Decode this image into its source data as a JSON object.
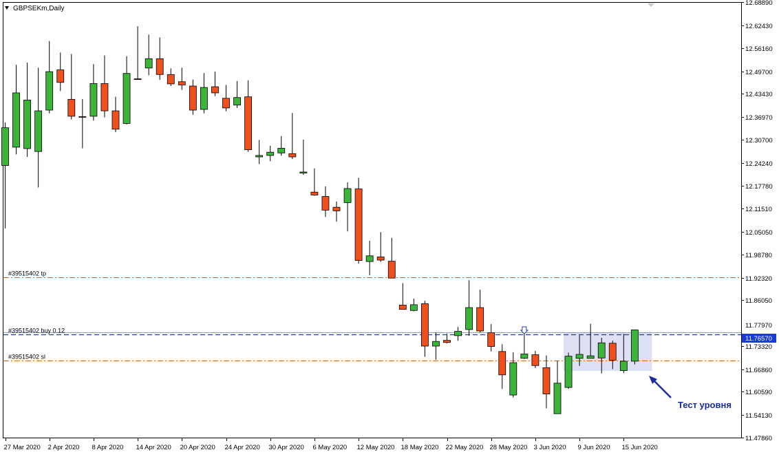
{
  "window": {
    "title": "GBPSEKm,Daily"
  },
  "colors": {
    "bull": "#3cb43c",
    "bear": "#f0501e",
    "wick": "#000000",
    "trade_level": "#d2691e",
    "buy_line": "#1f3f7a",
    "current_price_bg": "#1a3cd6",
    "annotation": "#1a2aa0",
    "highlight": "#d8dcf4"
  },
  "chart_data": {
    "type": "candlestick",
    "symbol": "GBPSEKm",
    "timeframe": "Daily",
    "ylim": [
      11.4786,
      12.6889
    ],
    "y_ticks": [
      "12.68890",
      "12.62430",
      "12.56160",
      "12.49700",
      "12.43430",
      "12.36970",
      "12.30700",
      "12.24240",
      "12.17780",
      "12.11510",
      "12.05050",
      "11.98780",
      "11.92320",
      "11.86050",
      "11.79590",
      "11.73320",
      "11.66860",
      "11.60590",
      "11.54130",
      "11.47860"
    ],
    "x_ticks": [
      "27 Mar 2020",
      "2 Apr 2020",
      "8 Apr 2020",
      "14 Apr 2020",
      "20 Apr 2020",
      "24 Apr 2020",
      "30 Apr 2020",
      "6 May 2020",
      "12 May 2020",
      "18 May 2020",
      "22 May 2020",
      "28 May 2020",
      "3 Jun 2020",
      "9 Jun 2020",
      "15 Jun 2020"
    ],
    "x_tick_bar_index": [
      0,
      4,
      8,
      12,
      16,
      20,
      24,
      28,
      32,
      36,
      40,
      44,
      48,
      52,
      56
    ],
    "candles": [
      {
        "o": 12.235,
        "h": 12.355,
        "l": 12.06,
        "c": 12.34
      },
      {
        "o": 12.286,
        "h": 12.515,
        "l": 12.266,
        "c": 12.437
      },
      {
        "o": 12.282,
        "h": 12.521,
        "l": 12.259,
        "c": 12.417
      },
      {
        "o": 12.274,
        "h": 12.507,
        "l": 12.174,
        "c": 12.387
      },
      {
        "o": 12.389,
        "h": 12.581,
        "l": 12.38,
        "c": 12.496
      },
      {
        "o": 12.501,
        "h": 12.549,
        "l": 12.442,
        "c": 12.466
      },
      {
        "o": 12.419,
        "h": 12.545,
        "l": 12.363,
        "c": 12.372
      },
      {
        "o": 12.371,
        "h": 12.42,
        "l": 12.283,
        "c": 12.369
      },
      {
        "o": 12.372,
        "h": 12.517,
        "l": 12.36,
        "c": 12.463
      },
      {
        "o": 12.463,
        "h": 12.541,
        "l": 12.369,
        "c": 12.387
      },
      {
        "o": 12.387,
        "h": 12.426,
        "l": 12.328,
        "c": 12.336
      },
      {
        "o": 12.352,
        "h": 12.539,
        "l": 12.349,
        "c": 12.491
      },
      {
        "o": 12.476,
        "h": 12.622,
        "l": 12.474,
        "c": 12.474
      },
      {
        "o": 12.506,
        "h": 12.599,
        "l": 12.486,
        "c": 12.532
      },
      {
        "o": 12.532,
        "h": 12.591,
        "l": 12.473,
        "c": 12.488
      },
      {
        "o": 12.488,
        "h": 12.505,
        "l": 12.456,
        "c": 12.462
      },
      {
        "o": 12.468,
        "h": 12.507,
        "l": 12.445,
        "c": 12.459
      },
      {
        "o": 12.456,
        "h": 12.474,
        "l": 12.376,
        "c": 12.389
      },
      {
        "o": 12.391,
        "h": 12.492,
        "l": 12.38,
        "c": 12.452
      },
      {
        "o": 12.454,
        "h": 12.496,
        "l": 12.428,
        "c": 12.437
      },
      {
        "o": 12.422,
        "h": 12.459,
        "l": 12.386,
        "c": 12.395
      },
      {
        "o": 12.403,
        "h": 12.47,
        "l": 12.395,
        "c": 12.424
      },
      {
        "o": 12.426,
        "h": 12.472,
        "l": 12.273,
        "c": 12.279
      },
      {
        "o": 12.259,
        "h": 12.306,
        "l": 12.239,
        "c": 12.263
      },
      {
        "o": 12.263,
        "h": 12.29,
        "l": 12.247,
        "c": 12.272
      },
      {
        "o": 12.27,
        "h": 12.317,
        "l": 12.262,
        "c": 12.283
      },
      {
        "o": 12.268,
        "h": 12.381,
        "l": 12.253,
        "c": 12.259
      },
      {
        "o": 12.214,
        "h": 12.307,
        "l": 12.209,
        "c": 12.217
      },
      {
        "o": 12.161,
        "h": 12.227,
        "l": 12.151,
        "c": 12.153
      },
      {
        "o": 12.149,
        "h": 12.177,
        "l": 12.092,
        "c": 12.111
      },
      {
        "o": 12.119,
        "h": 12.135,
        "l": 12.079,
        "c": 12.109
      },
      {
        "o": 12.132,
        "h": 12.188,
        "l": 12.052,
        "c": 12.171
      },
      {
        "o": 12.17,
        "h": 12.201,
        "l": 11.962,
        "c": 11.971
      },
      {
        "o": 11.968,
        "h": 12.026,
        "l": 11.93,
        "c": 11.984
      },
      {
        "o": 11.981,
        "h": 12.05,
        "l": 11.967,
        "c": 11.972
      },
      {
        "o": 11.969,
        "h": 12.034,
        "l": 11.926,
        "c": 11.922
      },
      {
        "o": 11.847,
        "h": 11.908,
        "l": 11.835,
        "c": 11.835
      },
      {
        "o": 11.832,
        "h": 11.865,
        "l": 11.83,
        "c": 11.848
      },
      {
        "o": 11.851,
        "h": 11.859,
        "l": 11.703,
        "c": 11.733
      },
      {
        "o": 11.733,
        "h": 11.771,
        "l": 11.695,
        "c": 11.746
      },
      {
        "o": 11.749,
        "h": 11.768,
        "l": 11.741,
        "c": 11.743
      },
      {
        "o": 11.762,
        "h": 11.786,
        "l": 11.748,
        "c": 11.774
      },
      {
        "o": 11.779,
        "h": 11.916,
        "l": 11.762,
        "c": 11.84
      },
      {
        "o": 11.84,
        "h": 11.89,
        "l": 11.771,
        "c": 11.775
      },
      {
        "o": 11.77,
        "h": 11.794,
        "l": 11.718,
        "c": 11.732
      },
      {
        "o": 11.718,
        "h": 11.738,
        "l": 11.614,
        "c": 11.653
      },
      {
        "o": 11.597,
        "h": 11.716,
        "l": 11.59,
        "c": 11.687
      },
      {
        "o": 11.699,
        "h": 11.774,
        "l": 11.697,
        "c": 11.711
      },
      {
        "o": 11.709,
        "h": 11.72,
        "l": 11.672,
        "c": 11.679
      },
      {
        "o": 11.673,
        "h": 11.707,
        "l": 11.56,
        "c": 11.6
      },
      {
        "o": 11.545,
        "h": 11.692,
        "l": 11.546,
        "c": 11.63
      },
      {
        "o": 11.618,
        "h": 11.715,
        "l": 11.614,
        "c": 11.705
      },
      {
        "o": 11.699,
        "h": 11.763,
        "l": 11.678,
        "c": 11.71
      },
      {
        "o": 11.699,
        "h": 11.795,
        "l": 11.699,
        "c": 11.706
      },
      {
        "o": 11.7,
        "h": 11.756,
        "l": 11.657,
        "c": 11.742
      },
      {
        "o": 11.741,
        "h": 11.748,
        "l": 11.669,
        "c": 11.694
      },
      {
        "o": 11.665,
        "h": 11.767,
        "l": 11.658,
        "c": 11.691
      },
      {
        "o": 11.691,
        "h": 11.776,
        "l": 11.682,
        "c": 11.778
      }
    ],
    "levels": [
      {
        "label": "#39515402 tp",
        "price": 11.9245,
        "kind": "tp"
      },
      {
        "label": "#39515402 buy 0.12",
        "price": 11.7657,
        "kind": "buy"
      },
      {
        "label": "#39515402 sl",
        "price": 11.6922,
        "kind": "sl"
      }
    ],
    "price_tags": [
      {
        "text": "11.77970",
        "price": 11.7797
      },
      {
        "text": "11.76570",
        "price": 11.7657,
        "highlight": true
      }
    ],
    "highlight_zone": {
      "from_index": 51,
      "to_index": 58,
      "top": 11.77,
      "bottom": 11.664
    },
    "annotation": {
      "text": "Тест уровня"
    }
  }
}
